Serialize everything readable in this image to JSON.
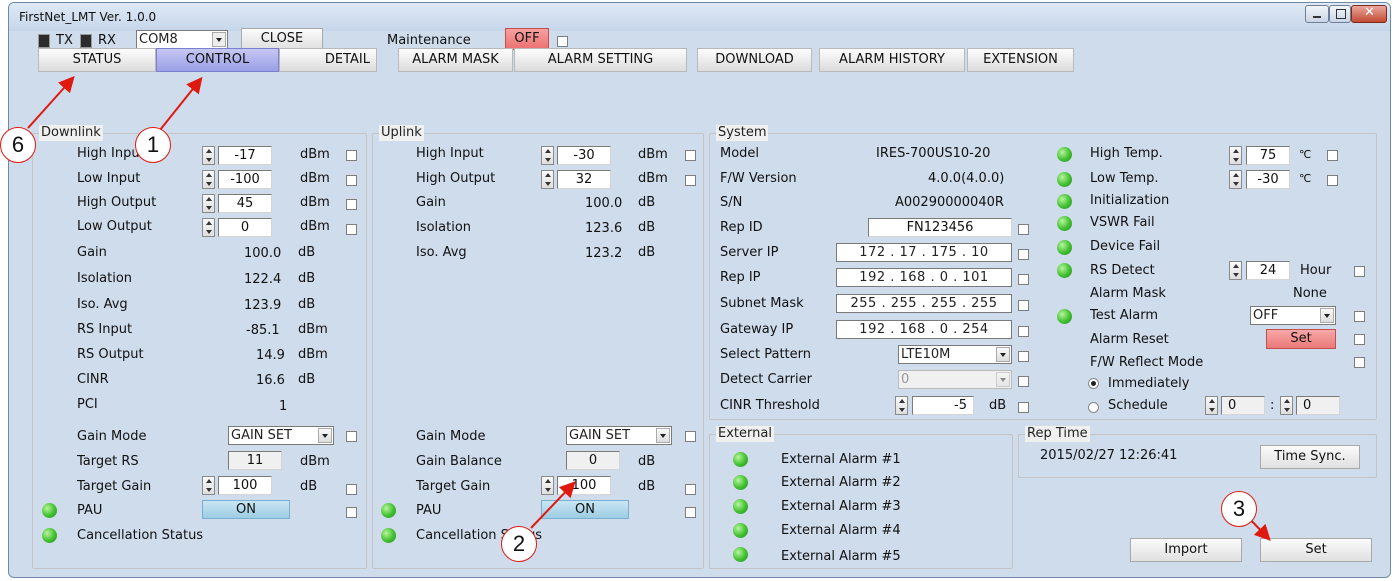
{
  "window": {
    "title": "FirstNet_LMT Ver. 1.0.0"
  },
  "toolbar": {
    "tx_label": "TX",
    "rx_label": "RX",
    "com_port": "COM8",
    "close_label": "CLOSE",
    "maintenance_label": "Maintenance",
    "maintenance_value": "OFF"
  },
  "tabs": [
    "STATUS",
    "CONTROL",
    "DETAIL",
    "ALARM MASK",
    "ALARM SETTING",
    "DOWNLOAD",
    "ALARM HISTORY",
    "EXTENSION"
  ],
  "downlink": {
    "title": "Downlink",
    "high_input": {
      "label": "High Input",
      "value": "-17",
      "unit": "dBm"
    },
    "low_input": {
      "label": "Low Input",
      "value": "-100",
      "unit": "dBm"
    },
    "high_output": {
      "label": "High Output",
      "value": "45",
      "unit": "dBm"
    },
    "low_output": {
      "label": "Low Output",
      "value": "0",
      "unit": "dBm"
    },
    "gain": {
      "label": "Gain",
      "value": "100.0",
      "unit": "dB"
    },
    "isolation": {
      "label": "Isolation",
      "value": "122.4",
      "unit": "dB"
    },
    "iso_avg": {
      "label": "Iso. Avg",
      "value": "123.9",
      "unit": "dB"
    },
    "rs_input": {
      "label": "RS Input",
      "value": "-85.1",
      "unit": "dBm"
    },
    "rs_output": {
      "label": "RS Output",
      "value": "14.9",
      "unit": "dBm"
    },
    "cinr": {
      "label": "CINR",
      "value": "16.6",
      "unit": "dB"
    },
    "pci": {
      "label": "PCI",
      "value": "1"
    },
    "gain_mode": {
      "label": "Gain Mode",
      "value": "GAIN SET"
    },
    "target_rs": {
      "label": "Target RS",
      "value": "11",
      "unit": "dBm"
    },
    "target_gain": {
      "label": "Target Gain",
      "value": "100",
      "unit": "dB"
    },
    "pau": {
      "label": "PAU",
      "value": "ON"
    },
    "cancellation": {
      "label": "Cancellation Status"
    }
  },
  "uplink": {
    "title": "Uplink",
    "high_input": {
      "label": "High Input",
      "value": "-30",
      "unit": "dBm"
    },
    "high_output": {
      "label": "High Output",
      "value": "32",
      "unit": "dBm"
    },
    "gain": {
      "label": "Gain",
      "value": "100.0",
      "unit": "dB"
    },
    "isolation": {
      "label": "Isolation",
      "value": "123.6",
      "unit": "dB"
    },
    "iso_avg": {
      "label": "Iso. Avg",
      "value": "123.2",
      "unit": "dB"
    },
    "gain_mode": {
      "label": "Gain Mode",
      "value": "GAIN SET"
    },
    "gain_balance": {
      "label": "Gain Balance",
      "value": "0",
      "unit": "dB"
    },
    "target_gain": {
      "label": "Target Gain",
      "value": "100",
      "unit": "dB"
    },
    "pau": {
      "label": "PAU",
      "value": "ON"
    },
    "cancellation": {
      "label": "Cancellation Status"
    }
  },
  "system": {
    "title": "System",
    "model": {
      "label": "Model",
      "value": "IRES-700US10-20"
    },
    "fw_version": {
      "label": "F/W Version",
      "value": "4.0.0(4.0.0)"
    },
    "sn": {
      "label": "S/N",
      "value": "A00290000040R"
    },
    "rep_id": {
      "label": "Rep ID",
      "value": "FN123456"
    },
    "server_ip": {
      "label": "Server IP",
      "value": "172 . 17 . 175 . 10"
    },
    "rep_ip": {
      "label": "Rep IP",
      "value": "192 . 168 .  0  . 101"
    },
    "subnet": {
      "label": "Subnet Mask",
      "value": "255 . 255 . 255 . 255"
    },
    "gateway": {
      "label": "Gateway IP",
      "value": "192 . 168 .  0  . 254"
    },
    "select_pattern": {
      "label": "Select Pattern",
      "value": "LTE10M"
    },
    "detect_carrier": {
      "label": "Detect Carrier",
      "value": "0"
    },
    "cinr_threshold": {
      "label": "CINR Threshold",
      "value": "-5",
      "unit": "dB"
    },
    "high_temp": {
      "label": "High Temp.",
      "value": "75",
      "unit": "℃"
    },
    "low_temp": {
      "label": "Low Temp.",
      "value": "-30",
      "unit": "℃"
    },
    "initialization": {
      "label": "Initialization"
    },
    "vswr_fail": {
      "label": "VSWR Fail"
    },
    "device_fail": {
      "label": "Device Fail"
    },
    "rs_detect": {
      "label": "RS Detect",
      "value": "24",
      "unit": "Hour"
    },
    "alarm_mask": {
      "label": "Alarm Mask",
      "value": "None"
    },
    "test_alarm": {
      "label": "Test Alarm",
      "value": "OFF"
    },
    "alarm_reset": {
      "label": "Alarm Reset",
      "button": "Set"
    },
    "fw_reflect": {
      "label": "F/W Reflect Mode"
    },
    "immediately": {
      "label": "Immediately"
    },
    "schedule": {
      "label": "Schedule",
      "hour": "0",
      "minute": "0",
      "separator": ":"
    }
  },
  "external": {
    "title": "External",
    "alarms": [
      "External Alarm #1",
      "External Alarm #2",
      "External Alarm #3",
      "External Alarm #4",
      "External Alarm #5"
    ]
  },
  "rep_time": {
    "title": "Rep Time",
    "value": "2015/02/27 12:26:41",
    "sync_label": "Time Sync."
  },
  "actions": {
    "import_label": "Import",
    "set_label": "Set"
  },
  "callouts": [
    "6",
    "1",
    "2",
    "3"
  ],
  "colors": {
    "active_tab": "#9a9fe6",
    "led_green": "#3fbf2f",
    "maintenance_off": "#f08080",
    "pau_on": "#a8d4e8",
    "callout": "#e0190e"
  }
}
